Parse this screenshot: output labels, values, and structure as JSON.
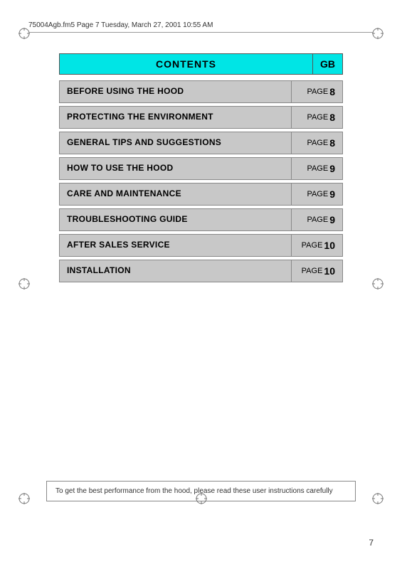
{
  "header": {
    "file_info": "75004Agb.fm5  Page 7  Tuesday, March 27, 2001  10:55 AM"
  },
  "contents": {
    "title": "CONTENTS",
    "gb_label": "GB",
    "rows": [
      {
        "id": "before-using",
        "title": "BEFORE USING THE HOOD",
        "page_word": "PAGE",
        "page_num": "8",
        "cyan": false
      },
      {
        "id": "protecting",
        "title": "PROTECTING THE ENVIRONMENT",
        "page_word": "PAGE",
        "page_num": "8",
        "cyan": false
      },
      {
        "id": "general-tips",
        "title": "GENERAL TIPS AND SUGGESTIONS",
        "page_word": "PAGE",
        "page_num": "8",
        "cyan": false
      },
      {
        "id": "how-to-use",
        "title": "HOW TO USE THE HOOD",
        "page_word": "PAGE",
        "page_num": "9",
        "cyan": false
      },
      {
        "id": "care",
        "title": "CARE AND MAINTENANCE",
        "page_word": "PAGE",
        "page_num": "9",
        "cyan": false
      },
      {
        "id": "troubleshooting",
        "title": "TROUBLESHOOTING GUIDE",
        "page_word": "PAGE",
        "page_num": "9",
        "cyan": false
      },
      {
        "id": "after-sales",
        "title": "AFTER SALES SERVICE",
        "page_word": "PAGE",
        "page_num": "10",
        "cyan": false
      },
      {
        "id": "installation",
        "title": "INSTALLATION",
        "page_word": "PAGE",
        "page_num": "10",
        "cyan": false
      }
    ]
  },
  "footer": {
    "note": "To get the best performance from the hood, please read these user instructions carefully"
  },
  "page_number": "7"
}
